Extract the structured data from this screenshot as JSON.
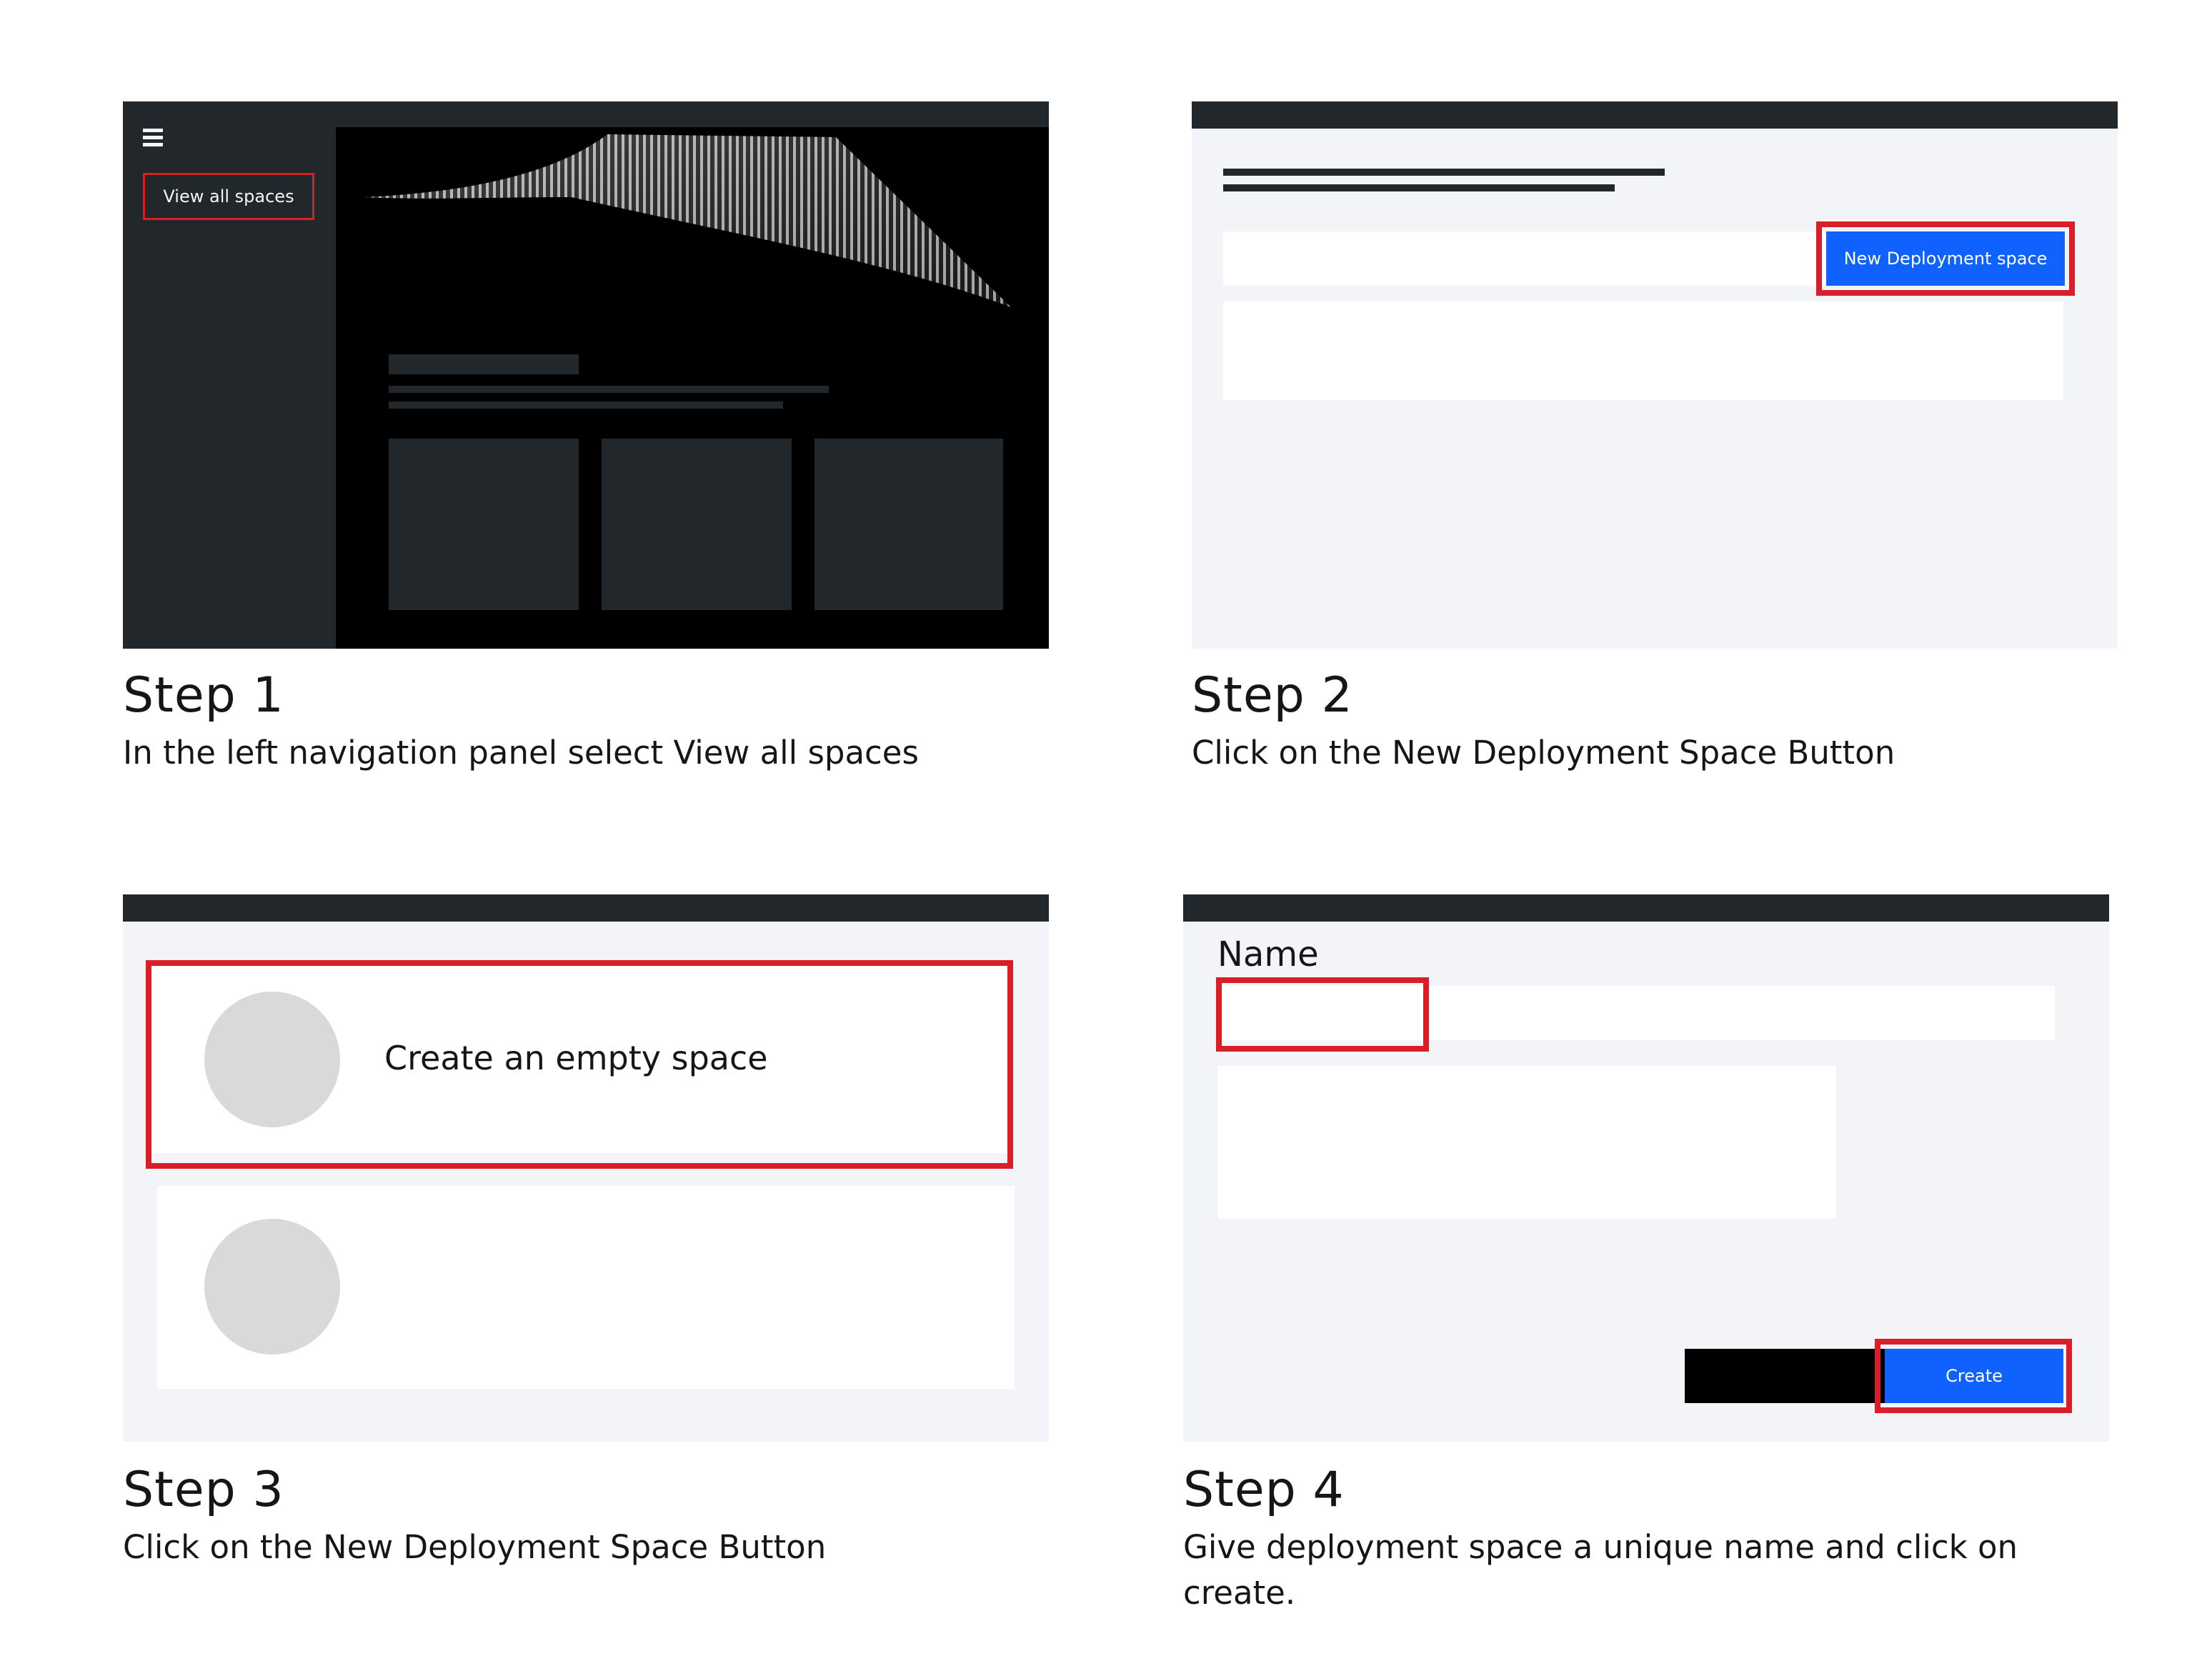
{
  "steps": [
    {
      "title": "Step 1",
      "description": "In the left navigation panel select View all spaces",
      "screen": {
        "nav_button_label": "View all spaces",
        "menu_icon": "hamburger-menu-icon"
      }
    },
    {
      "title": "Step 2",
      "description": "Click on the New Deployment Space Button",
      "screen": {
        "new_button_label": "New Deployment space"
      }
    },
    {
      "title": "Step 3",
      "description": "Click on the New Deployment Space Button",
      "screen": {
        "option_label": "Create an empty space"
      }
    },
    {
      "title": "Step 4",
      "description": "Give deployment space a unique name and click on create.",
      "screen": {
        "name_label": "Name",
        "create_button_label": "Create"
      }
    }
  ],
  "colors": {
    "highlight": "#da1e28",
    "primary_button": "#0f62fe",
    "dark_bar": "#21272a",
    "panel_background": "#f2f4f8"
  }
}
